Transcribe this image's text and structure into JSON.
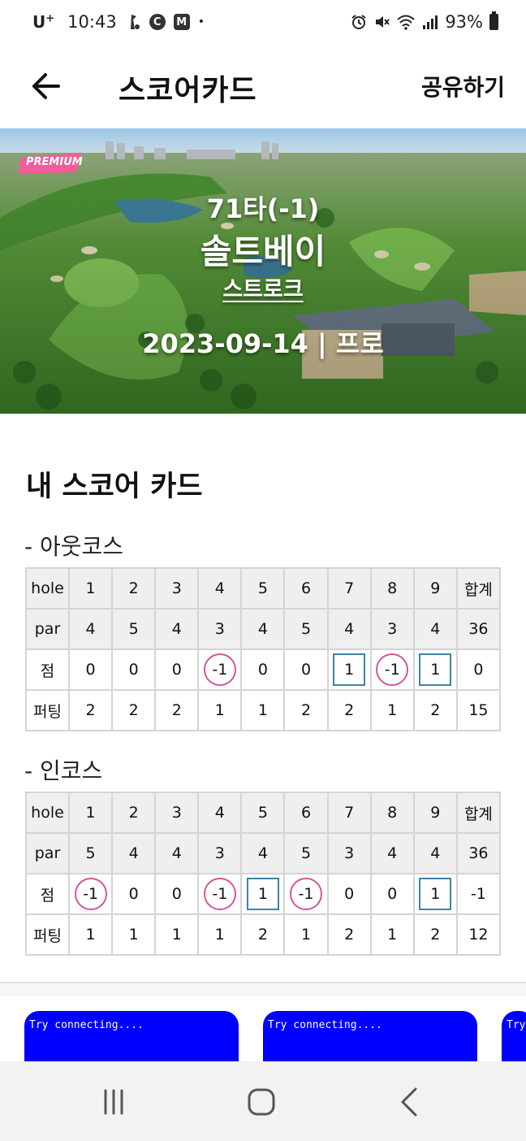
{
  "status_bar": {
    "carrier": "U",
    "carrier_sup": "+",
    "time": "10:43",
    "app_icons": [
      "C",
      "M"
    ],
    "dot": "•",
    "battery": "93%"
  },
  "app_bar": {
    "title": "스코어카드",
    "share": "공유하기"
  },
  "banner": {
    "badge": "PREMIUM",
    "score": "71타(-1)",
    "course": "솔트베이",
    "mode": "스트로크",
    "meta": "2023-09-14 | 프로"
  },
  "section_title": "내 스코어 카드",
  "out_course": {
    "label": "- 아웃코스",
    "row_labels": [
      "hole",
      "par",
      "점",
      "퍼팅"
    ],
    "holes": [
      "1",
      "2",
      "3",
      "4",
      "5",
      "6",
      "7",
      "8",
      "9",
      "합계"
    ],
    "par": [
      "4",
      "5",
      "4",
      "3",
      "4",
      "5",
      "4",
      "3",
      "4",
      "36"
    ],
    "score": [
      "0",
      "0",
      "0",
      "-1",
      "0",
      "0",
      "1",
      "-1",
      "1",
      "0"
    ],
    "putting": [
      "2",
      "2",
      "2",
      "1",
      "1",
      "2",
      "2",
      "1",
      "2",
      "15"
    ]
  },
  "in_course": {
    "label": "- 인코스",
    "row_labels": [
      "hole",
      "par",
      "점",
      "퍼팅"
    ],
    "holes": [
      "1",
      "2",
      "3",
      "4",
      "5",
      "6",
      "7",
      "8",
      "9",
      "합계"
    ],
    "par": [
      "5",
      "4",
      "4",
      "3",
      "4",
      "5",
      "3",
      "4",
      "4",
      "36"
    ],
    "score": [
      "-1",
      "0",
      "0",
      "-1",
      "1",
      "-1",
      "0",
      "0",
      "1",
      "-1"
    ],
    "putting": [
      "1",
      "1",
      "1",
      "1",
      "2",
      "1",
      "2",
      "1",
      "2",
      "12"
    ]
  },
  "ads": [
    "Try connecting....",
    "Try connecting....",
    "Try"
  ],
  "colors": {
    "birdie": "#d5549d",
    "bogey": "#3f83a8",
    "ad": "#0000ff",
    "premium": "#ef5e9a"
  }
}
